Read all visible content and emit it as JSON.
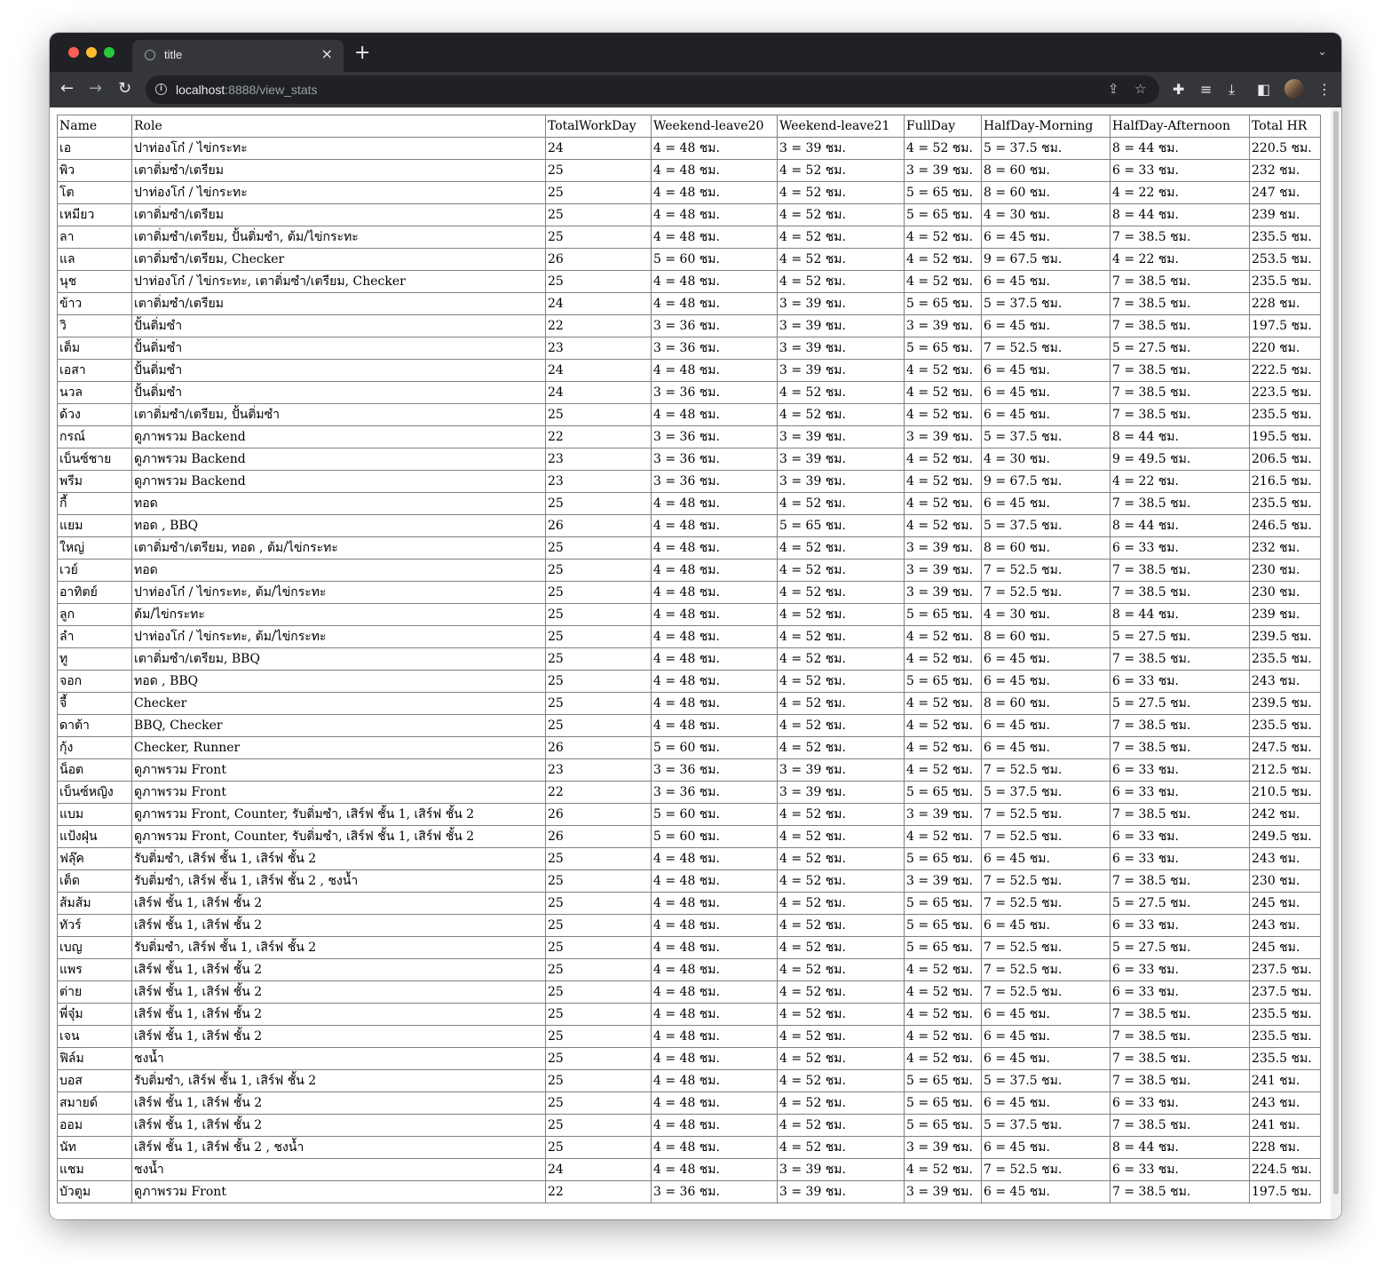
{
  "browser": {
    "tab_title": "title",
    "tab_close": "×",
    "new_tab": "+",
    "url_host": "localhost",
    "url_rest": ":8888/view_stats"
  },
  "table": {
    "headers": [
      "Name",
      "Role",
      "TotalWorkDay",
      "Weekend-leave20",
      "Weekend-leave21",
      "FullDay",
      "HalfDay-Morning",
      "HalfDay-Afternoon",
      "Total HR"
    ],
    "rows": [
      [
        "เอ",
        "ปาท่องโก๋ / ไข่กระทะ",
        "24",
        "4 = 48 ชม.",
        "3 = 39 ชม.",
        "4 = 52 ชม.",
        "5 = 37.5 ชม.",
        "8 = 44 ชม.",
        "220.5 ชม."
      ],
      [
        "พิว",
        "เตาติ่มซำ/เตรียม",
        "25",
        "4 = 48 ชม.",
        "4 = 52 ชม.",
        "3 = 39 ชม.",
        "8 = 60 ชม.",
        "6 = 33 ชม.",
        "232 ชม."
      ],
      [
        "โต",
        "ปาท่องโก๋ / ไข่กระทะ",
        "25",
        "4 = 48 ชม.",
        "4 = 52 ชม.",
        "5 = 65 ชม.",
        "8 = 60 ชม.",
        "4 = 22 ชม.",
        "247 ชม."
      ],
      [
        "เหมียว",
        "เตาติ่มซำ/เตรียม",
        "25",
        "4 = 48 ชม.",
        "4 = 52 ชม.",
        "5 = 65 ชม.",
        "4 = 30 ชม.",
        "8 = 44 ชม.",
        "239 ชม."
      ],
      [
        "ลา",
        "เตาติ่มซำ/เตรียม, ปั้นติ่มซำ, ต้ม/ไข่กระทะ",
        "25",
        "4 = 48 ชม.",
        "4 = 52 ชม.",
        "4 = 52 ชม.",
        "6 = 45 ชม.",
        "7 = 38.5 ชม.",
        "235.5 ชม."
      ],
      [
        "แล",
        "เตาติ่มซำ/เตรียม, Checker",
        "26",
        "5 = 60 ชม.",
        "4 = 52 ชม.",
        "4 = 52 ชม.",
        "9 = 67.5 ชม.",
        "4 = 22 ชม.",
        "253.5 ชม."
      ],
      [
        "นุช",
        "ปาท่องโก๋ / ไข่กระทะ, เตาติ่มซำ/เตรียม, Checker",
        "25",
        "4 = 48 ชม.",
        "4 = 52 ชม.",
        "4 = 52 ชม.",
        "6 = 45 ชม.",
        "7 = 38.5 ชม.",
        "235.5 ชม."
      ],
      [
        "ข้าว",
        "เตาติ่มซำ/เตรียม",
        "24",
        "4 = 48 ชม.",
        "3 = 39 ชม.",
        "5 = 65 ชม.",
        "5 = 37.5 ชม.",
        "7 = 38.5 ชม.",
        "228 ชม."
      ],
      [
        "วิ",
        "ปั้นติ่มซำ",
        "22",
        "3 = 36 ชม.",
        "3 = 39 ชม.",
        "3 = 39 ชม.",
        "6 = 45 ชม.",
        "7 = 38.5 ชม.",
        "197.5 ชม."
      ],
      [
        "เต็ม",
        "ปั้นติ่มซำ",
        "23",
        "3 = 36 ชม.",
        "3 = 39 ชม.",
        "5 = 65 ชม.",
        "7 = 52.5 ชม.",
        "5 = 27.5 ชม.",
        "220 ชม."
      ],
      [
        "เอสา",
        "ปั้นติ่มซำ",
        "24",
        "4 = 48 ชม.",
        "3 = 39 ชม.",
        "4 = 52 ชม.",
        "6 = 45 ชม.",
        "7 = 38.5 ชม.",
        "222.5 ชม."
      ],
      [
        "นวล",
        "ปั้นติ่มซำ",
        "24",
        "3 = 36 ชม.",
        "4 = 52 ชม.",
        "4 = 52 ชม.",
        "6 = 45 ชม.",
        "7 = 38.5 ชม.",
        "223.5 ชม."
      ],
      [
        "ด้วง",
        "เตาติ่มซำ/เตรียม, ปั้นติ่มซำ",
        "25",
        "4 = 48 ชม.",
        "4 = 52 ชม.",
        "4 = 52 ชม.",
        "6 = 45 ชม.",
        "7 = 38.5 ชม.",
        "235.5 ชม."
      ],
      [
        "กรณ์",
        "ดูภาพรวม Backend",
        "22",
        "3 = 36 ชม.",
        "3 = 39 ชม.",
        "3 = 39 ชม.",
        "5 = 37.5 ชม.",
        "8 = 44 ชม.",
        "195.5 ชม."
      ],
      [
        "เบ็นซ์ชาย",
        "ดูภาพรวม Backend",
        "23",
        "3 = 36 ชม.",
        "3 = 39 ชม.",
        "4 = 52 ชม.",
        "4 = 30 ชม.",
        "9 = 49.5 ชม.",
        "206.5 ชม."
      ],
      [
        "พรีม",
        "ดูภาพรวม Backend",
        "23",
        "3 = 36 ชม.",
        "3 = 39 ชม.",
        "4 = 52 ชม.",
        "9 = 67.5 ชม.",
        "4 = 22 ชม.",
        "216.5 ชม."
      ],
      [
        "กี้",
        "ทอด",
        "25",
        "4 = 48 ชม.",
        "4 = 52 ชม.",
        "4 = 52 ชม.",
        "6 = 45 ชม.",
        "7 = 38.5 ชม.",
        "235.5 ชม."
      ],
      [
        "แยม",
        "ทอด , BBQ",
        "26",
        "4 = 48 ชม.",
        "5 = 65 ชม.",
        "4 = 52 ชม.",
        "5 = 37.5 ชม.",
        "8 = 44 ชม.",
        "246.5 ชม."
      ],
      [
        "ใหญ่",
        "เตาติ่มซำ/เตรียม, ทอด , ต้ม/ไข่กระทะ",
        "25",
        "4 = 48 ชม.",
        "4 = 52 ชม.",
        "3 = 39 ชม.",
        "8 = 60 ชม.",
        "6 = 33 ชม.",
        "232 ชม."
      ],
      [
        "เวย์",
        "ทอด",
        "25",
        "4 = 48 ชม.",
        "4 = 52 ชม.",
        "3 = 39 ชม.",
        "7 = 52.5 ชม.",
        "7 = 38.5 ชม.",
        "230 ชม."
      ],
      [
        "อาทิตย์",
        "ปาท่องโก๋ / ไข่กระทะ, ต้ม/ไข่กระทะ",
        "25",
        "4 = 48 ชม.",
        "4 = 52 ชม.",
        "3 = 39 ชม.",
        "7 = 52.5 ชม.",
        "7 = 38.5 ชม.",
        "230 ชม."
      ],
      [
        "ลูก",
        "ต้ม/ไข่กระทะ",
        "25",
        "4 = 48 ชม.",
        "4 = 52 ชม.",
        "5 = 65 ชม.",
        "4 = 30 ชม.",
        "8 = 44 ชม.",
        "239 ชม."
      ],
      [
        "ลำ",
        "ปาท่องโก๋ / ไข่กระทะ, ต้ม/ไข่กระทะ",
        "25",
        "4 = 48 ชม.",
        "4 = 52 ชม.",
        "4 = 52 ชม.",
        "8 = 60 ชม.",
        "5 = 27.5 ชม.",
        "239.5 ชม."
      ],
      [
        "ทู",
        "เตาติ่มซำ/เตรียม, BBQ",
        "25",
        "4 = 48 ชม.",
        "4 = 52 ชม.",
        "4 = 52 ชม.",
        "6 = 45 ชม.",
        "7 = 38.5 ชม.",
        "235.5 ชม."
      ],
      [
        "จอก",
        "ทอด , BBQ",
        "25",
        "4 = 48 ชม.",
        "4 = 52 ชม.",
        "5 = 65 ชม.",
        "6 = 45 ชม.",
        "6 = 33 ชม.",
        "243 ชม."
      ],
      [
        "จี้",
        "Checker",
        "25",
        "4 = 48 ชม.",
        "4 = 52 ชม.",
        "4 = 52 ชม.",
        "8 = 60 ชม.",
        "5 = 27.5 ชม.",
        "239.5 ชม."
      ],
      [
        "ดาต้า",
        "BBQ, Checker",
        "25",
        "4 = 48 ชม.",
        "4 = 52 ชม.",
        "4 = 52 ชม.",
        "6 = 45 ชม.",
        "7 = 38.5 ชม.",
        "235.5 ชม."
      ],
      [
        "กุ้ง",
        "Checker, Runner",
        "26",
        "5 = 60 ชม.",
        "4 = 52 ชม.",
        "4 = 52 ชม.",
        "6 = 45 ชม.",
        "7 = 38.5 ชม.",
        "247.5 ชม."
      ],
      [
        "น็อต",
        "ดูภาพรวม Front",
        "23",
        "3 = 36 ชม.",
        "3 = 39 ชม.",
        "4 = 52 ชม.",
        "7 = 52.5 ชม.",
        "6 = 33 ชม.",
        "212.5 ชม."
      ],
      [
        "เบ็นซ์หญิง",
        "ดูภาพรวม Front",
        "22",
        "3 = 36 ชม.",
        "3 = 39 ชม.",
        "5 = 65 ชม.",
        "5 = 37.5 ชม.",
        "6 = 33 ชม.",
        "210.5 ชม."
      ],
      [
        "แบม",
        "ดูภาพรวม Front, Counter, รับติ่มซำ, เสิร์ฟ ชั้น 1, เสิร์ฟ ชั้น 2",
        "26",
        "5 = 60 ชม.",
        "4 = 52 ชม.",
        "3 = 39 ชม.",
        "7 = 52.5 ชม.",
        "7 = 38.5 ชม.",
        "242 ชม."
      ],
      [
        "แป้งฝุ่น",
        "ดูภาพรวม Front, Counter, รับติ่มซำ, เสิร์ฟ ชั้น 1, เสิร์ฟ ชั้น 2",
        "26",
        "5 = 60 ชม.",
        "4 = 52 ชม.",
        "4 = 52 ชม.",
        "7 = 52.5 ชม.",
        "6 = 33 ชม.",
        "249.5 ชม."
      ],
      [
        "ฟลุ๊ค",
        "รับติ่มซำ, เสิร์ฟ ชั้น 1, เสิร์ฟ ชั้น 2",
        "25",
        "4 = 48 ชม.",
        "4 = 52 ชม.",
        "5 = 65 ชม.",
        "6 = 45 ชม.",
        "6 = 33 ชม.",
        "243 ชม."
      ],
      [
        "เต็ด",
        "รับติ่มซำ, เสิร์ฟ ชั้น 1, เสิร์ฟ ชั้น 2 , ชงน้ำ",
        "25",
        "4 = 48 ชม.",
        "4 = 52 ชม.",
        "3 = 39 ชม.",
        "7 = 52.5 ชม.",
        "7 = 38.5 ชม.",
        "230 ชม."
      ],
      [
        "ส้มส้ม",
        "เสิร์ฟ ชั้น 1, เสิร์ฟ ชั้น 2",
        "25",
        "4 = 48 ชม.",
        "4 = 52 ชม.",
        "5 = 65 ชม.",
        "7 = 52.5 ชม.",
        "5 = 27.5 ชม.",
        "245 ชม."
      ],
      [
        "ทัวร์",
        "เสิร์ฟ ชั้น 1, เสิร์ฟ ชั้น 2",
        "25",
        "4 = 48 ชม.",
        "4 = 52 ชม.",
        "5 = 65 ชม.",
        "6 = 45 ชม.",
        "6 = 33 ชม.",
        "243 ชม."
      ],
      [
        "เบญ",
        "รับติ่มซำ, เสิร์ฟ ชั้น 1, เสิร์ฟ ชั้น 2",
        "25",
        "4 = 48 ชม.",
        "4 = 52 ชม.",
        "5 = 65 ชม.",
        "7 = 52.5 ชม.",
        "5 = 27.5 ชม.",
        "245 ชม."
      ],
      [
        "แพร",
        "เสิร์ฟ ชั้น 1, เสิร์ฟ ชั้น 2",
        "25",
        "4 = 48 ชม.",
        "4 = 52 ชม.",
        "4 = 52 ชม.",
        "7 = 52.5 ชม.",
        "6 = 33 ชม.",
        "237.5 ชม."
      ],
      [
        "ต่าย",
        "เสิร์ฟ ชั้น 1, เสิร์ฟ ชั้น 2",
        "25",
        "4 = 48 ชม.",
        "4 = 52 ชม.",
        "4 = 52 ชม.",
        "7 = 52.5 ชม.",
        "6 = 33 ชม.",
        "237.5 ชม."
      ],
      [
        "พี่จุ๋ม",
        "เสิร์ฟ ชั้น 1, เสิร์ฟ ชั้น 2",
        "25",
        "4 = 48 ชม.",
        "4 = 52 ชม.",
        "4 = 52 ชม.",
        "6 = 45 ชม.",
        "7 = 38.5 ชม.",
        "235.5 ชม."
      ],
      [
        "เจน",
        "เสิร์ฟ ชั้น 1, เสิร์ฟ ชั้น 2",
        "25",
        "4 = 48 ชม.",
        "4 = 52 ชม.",
        "4 = 52 ชม.",
        "6 = 45 ชม.",
        "7 = 38.5 ชม.",
        "235.5 ชม."
      ],
      [
        "ฟิล์ม",
        "ชงน้ำ",
        "25",
        "4 = 48 ชม.",
        "4 = 52 ชม.",
        "4 = 52 ชม.",
        "6 = 45 ชม.",
        "7 = 38.5 ชม.",
        "235.5 ชม."
      ],
      [
        "บอส",
        "รับติ่มซำ, เสิร์ฟ ชั้น 1, เสิร์ฟ ชั้น 2",
        "25",
        "4 = 48 ชม.",
        "4 = 52 ชม.",
        "5 = 65 ชม.",
        "5 = 37.5 ชม.",
        "7 = 38.5 ชม.",
        "241 ชม."
      ],
      [
        "สมายด์",
        "เสิร์ฟ ชั้น 1, เสิร์ฟ ชั้น 2",
        "25",
        "4 = 48 ชม.",
        "4 = 52 ชม.",
        "5 = 65 ชม.",
        "6 = 45 ชม.",
        "6 = 33 ชม.",
        "243 ชม."
      ],
      [
        "ออม",
        "เสิร์ฟ ชั้น 1, เสิร์ฟ ชั้น 2",
        "25",
        "4 = 48 ชม.",
        "4 = 52 ชม.",
        "5 = 65 ชม.",
        "5 = 37.5 ชม.",
        "7 = 38.5 ชม.",
        "241 ชม."
      ],
      [
        "นัท",
        "เสิร์ฟ ชั้น 1, เสิร์ฟ ชั้น 2 , ชงน้ำ",
        "25",
        "4 = 48 ชม.",
        "4 = 52 ชม.",
        "3 = 39 ชม.",
        "6 = 45 ชม.",
        "8 = 44 ชม.",
        "228 ชม."
      ],
      [
        "แชม",
        "ชงน้ำ",
        "24",
        "4 = 48 ชม.",
        "3 = 39 ชม.",
        "4 = 52 ชม.",
        "7 = 52.5 ชม.",
        "6 = 33 ชม.",
        "224.5 ชม."
      ],
      [
        "บัวตูม",
        "ดูภาพรวม Front",
        "22",
        "3 = 36 ชม.",
        "3 = 39 ชม.",
        "3 = 39 ชม.",
        "6 = 45 ชม.",
        "7 = 38.5 ชม.",
        "197.5 ชม."
      ]
    ]
  }
}
